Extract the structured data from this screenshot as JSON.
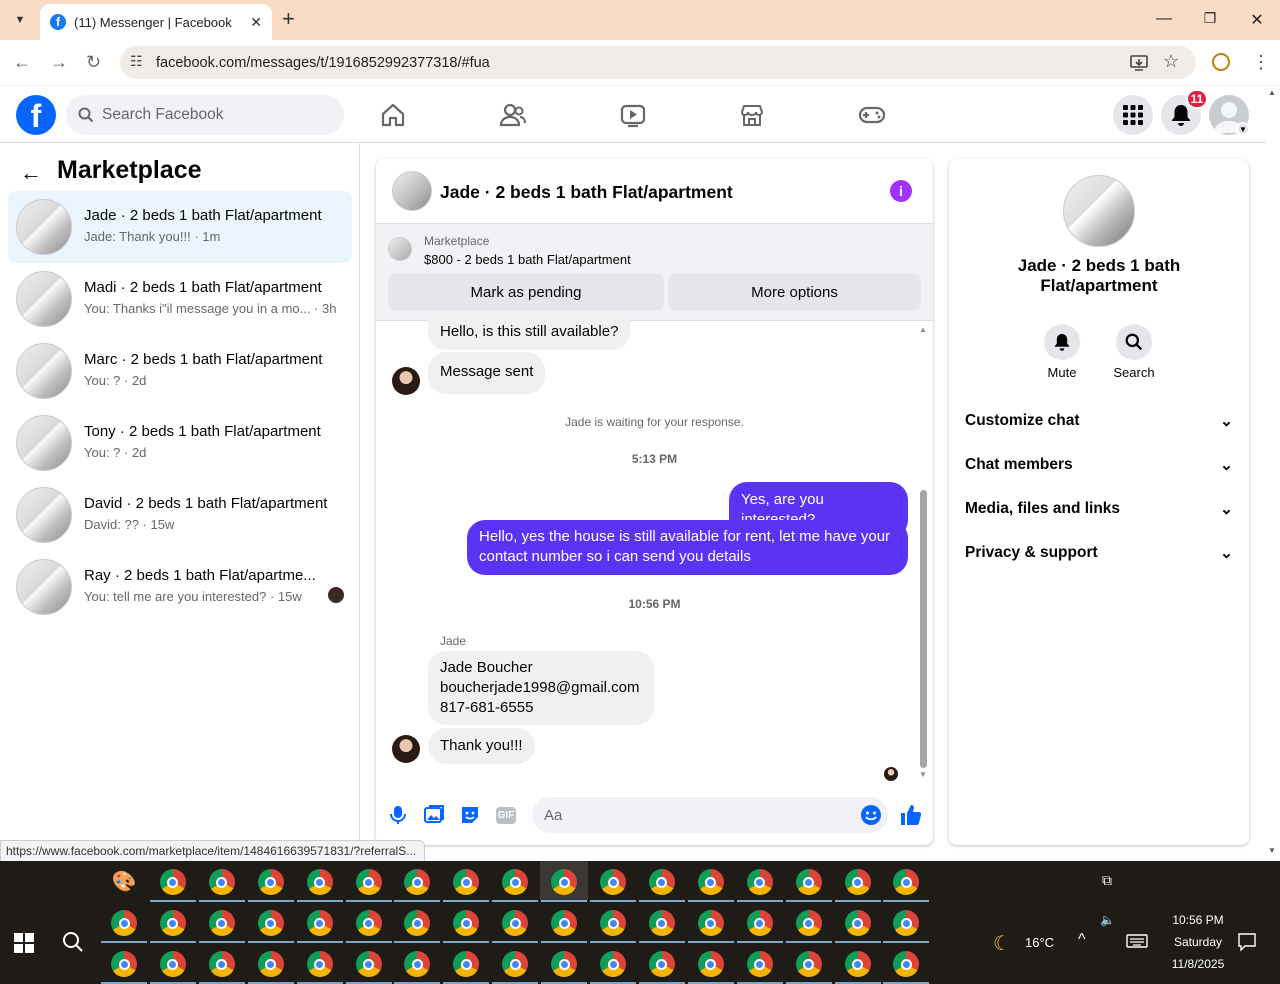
{
  "browser": {
    "tab_title": "(11) Messenger | Facebook",
    "url": "facebook.com/messages/t/1916852992377318/#fua",
    "status_link": "https://www.facebook.com/marketplace/item/1484616639571831/?referralS..."
  },
  "fb": {
    "search_placeholder": "Search Facebook",
    "notification_count": "11"
  },
  "left": {
    "title": "Marketplace",
    "conversations": [
      {
        "name": "Jade · 2 beds 1 bath Flat/apartment",
        "preview": "Jade: Thank you!!! · 1m"
      },
      {
        "name": "Madi · 2 beds 1 bath Flat/apartment",
        "preview": "You: Thanks i\"il message you in a mo...  · 3h"
      },
      {
        "name": "Marc · 2 beds 1 bath Flat/apartment",
        "preview": "You: ? · 2d"
      },
      {
        "name": "Tony · 2 beds 1 bath Flat/apartment",
        "preview": "You: ? · 2d"
      },
      {
        "name": "David · 2 beds 1 bath Flat/apartment",
        "preview": "David: ?? · 15w"
      },
      {
        "name": "Ray · 2 beds 1 bath Flat/apartme...",
        "preview": "You: tell me are you interested? · 15w"
      }
    ]
  },
  "chat": {
    "title": "Jade · 2 beds 1 bath Flat/apartment",
    "marketplace_label": "Marketplace",
    "listing": "$800 - 2 beds 1 bath Flat/apartment",
    "mark_pending": "Mark as pending",
    "more_options": "More options",
    "messages": {
      "m1": "Hello, is this still available?",
      "m2": "Message sent",
      "waiting": "Jade is waiting for your response.",
      "ts1": "5:13 PM",
      "m3": "Yes, are you interested?",
      "m4": "Hello, yes the house is still available for rent, let me have your contact number so i can send you details",
      "ts2": "10:56 PM",
      "sender": "Jade",
      "m5_line1": "Jade Boucher",
      "m5_line2": "boucherjade1998@gmail.com",
      "m5_line3": "817-681-6555",
      "m6": "Thank you!!!"
    },
    "composer_placeholder": "Aa"
  },
  "right": {
    "name": "Jade · 2 beds 1 bath Flat/apartment",
    "mute": "Mute",
    "search": "Search",
    "sections": [
      "Customize chat",
      "Chat members",
      "Media, files and links",
      "Privacy & support"
    ]
  },
  "taskbar": {
    "temperature": "16°C",
    "time": "10:56 PM",
    "day": "Saturday",
    "date": "11/8/2025"
  },
  "colors": {
    "fb_blue": "#0866ff",
    "outgoing_bubble": "#5b33f5",
    "info_purple": "#a033ff",
    "badge_red": "#e41e3f"
  }
}
